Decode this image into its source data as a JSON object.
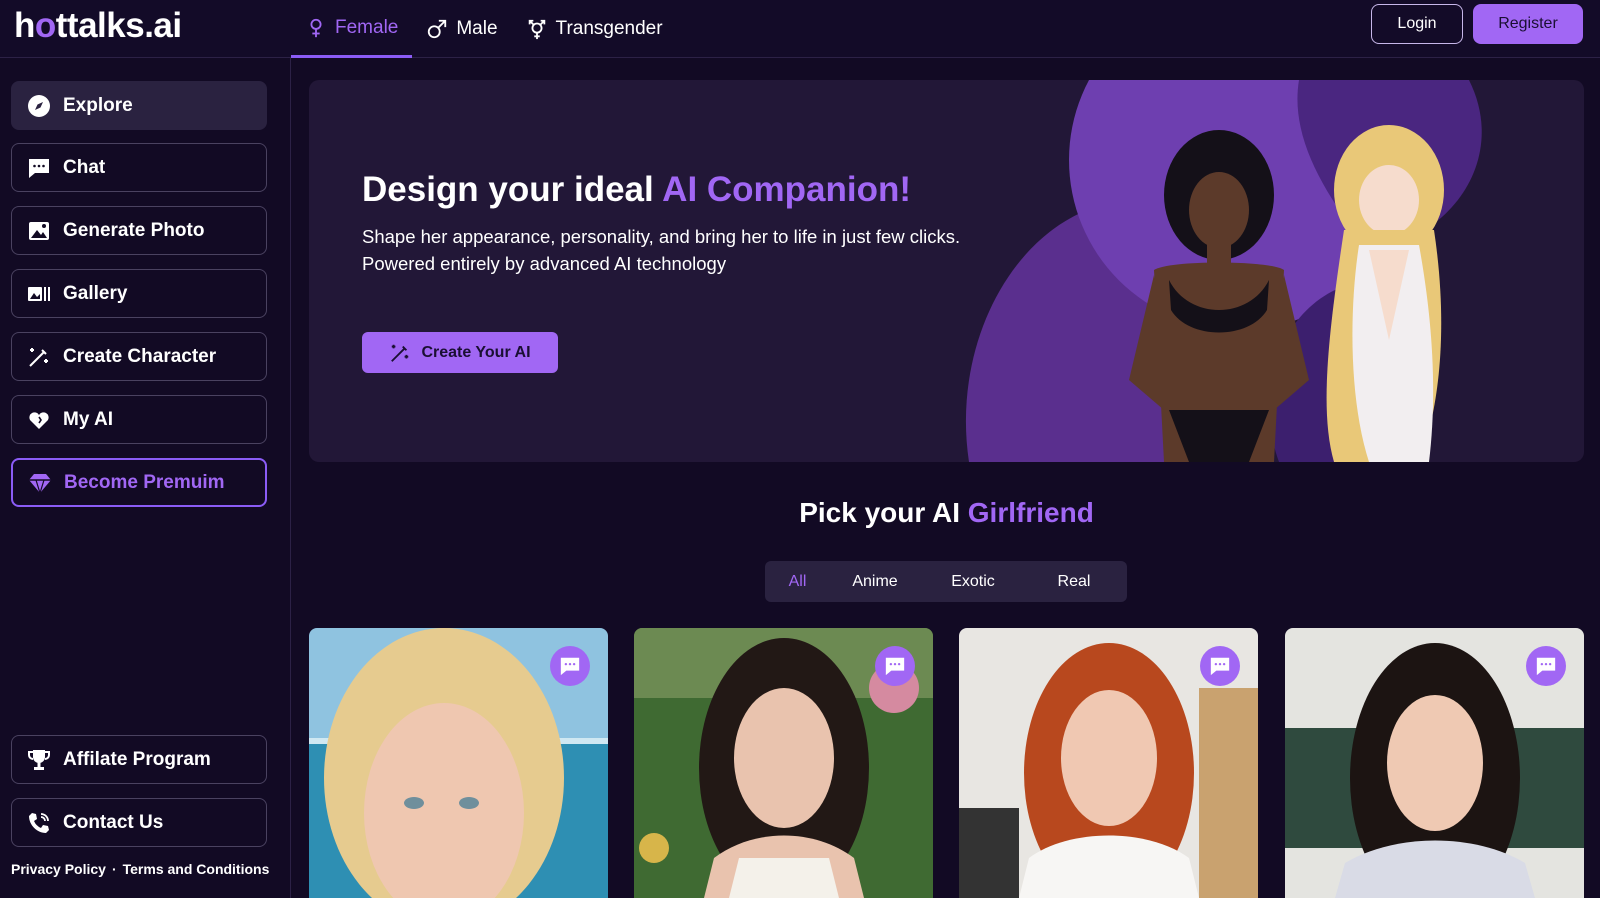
{
  "header": {
    "logo": {
      "before": "h",
      "o": "o",
      "after": "ttalks.ai"
    },
    "gender_tabs": [
      {
        "label": "Female",
        "icon": "female-icon",
        "active": true
      },
      {
        "label": "Male",
        "icon": "male-icon",
        "active": false
      },
      {
        "label": "Transgender",
        "icon": "transgender-icon",
        "active": false
      }
    ],
    "login_label": "Login",
    "register_label": "Register"
  },
  "sidebar": {
    "items": [
      {
        "label": "Explore",
        "icon": "compass-icon",
        "active": true
      },
      {
        "label": "Chat",
        "icon": "chat-icon"
      },
      {
        "label": "Generate Photo",
        "icon": "image-icon"
      },
      {
        "label": "Gallery",
        "icon": "gallery-icon"
      },
      {
        "label": "Create Character",
        "icon": "magic-wand-icon"
      },
      {
        "label": "My AI",
        "icon": "heart-icon"
      },
      {
        "label": "Become Premuim",
        "icon": "diamond-icon"
      }
    ],
    "bottom_items": [
      {
        "label": "Affilate Program",
        "icon": "trophy-icon"
      },
      {
        "label": "Contact Us",
        "icon": "phone-icon"
      }
    ],
    "footer": {
      "privacy": "Privacy Policy",
      "separator": "·",
      "terms": "Terms and Conditions"
    }
  },
  "hero": {
    "title_main": "Design your ideal ",
    "title_accent": "AI Companion!",
    "line1": "Shape her appearance, personality, and bring her to life in just few clicks.",
    "line2": "Powered entirely by advanced AI technology",
    "cta_label": "Create Your AI"
  },
  "pick": {
    "title_main": "Pick your AI ",
    "title_accent": "Girlfriend",
    "filters": [
      {
        "label": "All",
        "active": true
      },
      {
        "label": "Anime"
      },
      {
        "label": "Exotic"
      },
      {
        "label": "Real"
      }
    ]
  },
  "colors": {
    "accent": "#a167f4",
    "background": "#120a24",
    "panel": "#221737"
  }
}
